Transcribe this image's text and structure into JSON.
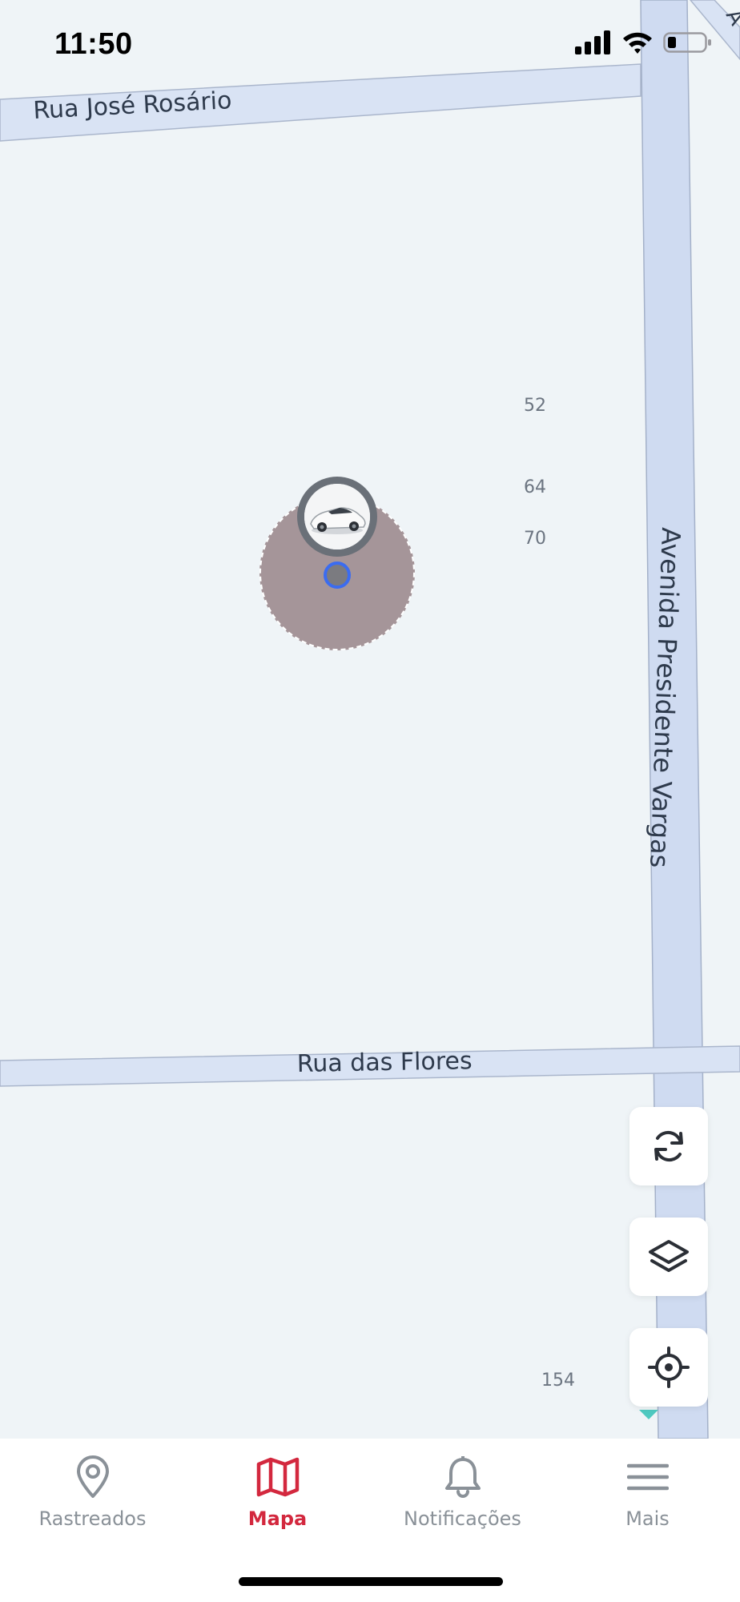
{
  "status_bar": {
    "time": "11:50"
  },
  "map": {
    "streets": {
      "rua_jose_rosario": "Rua José Rosário",
      "avenida_presidente_vargas": "Avenida Presidente Vargas",
      "rua_das_flores": "Rua das Flores"
    },
    "address_numbers": [
      "52",
      "64",
      "70",
      "154"
    ],
    "accuracy_color": "#887074",
    "location_dot_color": "#3b6cf0"
  },
  "map_controls": {
    "refresh_icon": "refresh-icon",
    "layers_icon": "layers-icon",
    "locate_icon": "crosshair-icon"
  },
  "tab_bar": {
    "active_color": "#d3283e",
    "inactive_color": "#8a9198",
    "tabs": [
      {
        "label": "Rastreados",
        "icon": "map-pin-icon"
      },
      {
        "label": "Mapa",
        "icon": "map-icon"
      },
      {
        "label": "Notificações",
        "icon": "bell-icon"
      },
      {
        "label": "Mais",
        "icon": "menu-icon"
      }
    ]
  }
}
